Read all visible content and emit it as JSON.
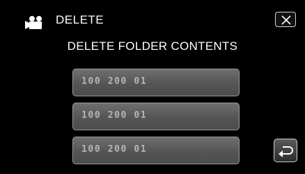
{
  "header": {
    "mode_icon": "video-camera-icon",
    "title": "DELETE",
    "close_icon": "close-icon"
  },
  "subtitle": "DELETE FOLDER CONTENTS",
  "folders": [
    {
      "label": "100 200 01"
    },
    {
      "label": "100 200 01"
    },
    {
      "label": "100 200 01"
    }
  ],
  "footer": {
    "back_icon": "return-arrow-icon"
  },
  "colors": {
    "background": "#000000",
    "button_fill": "#5a5a5a",
    "text": "#ffffff"
  }
}
